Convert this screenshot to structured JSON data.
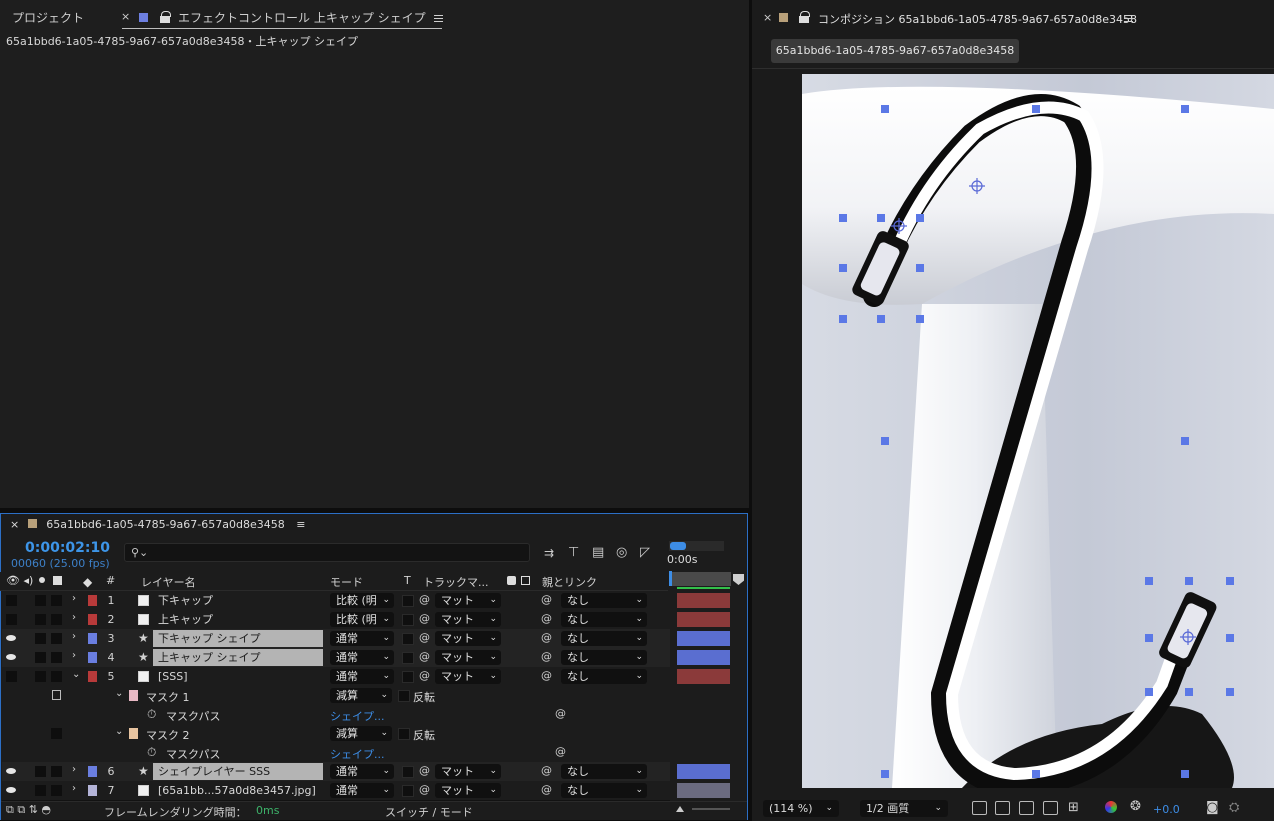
{
  "left_panel": {
    "project_tab": "プロジェクト",
    "effect_tab": "エフェクトコントロール 上キャップ シェイプ",
    "effect_subtitle": "65a1bbd6-1a05-4785-9a67-657a0d8e3458・上キャップ シェイプ",
    "effect_swatch_color": "#6d7fe0"
  },
  "timeline": {
    "tab_title": "65a1bbd6-1a05-4785-9a67-657a0d8e3458",
    "timecode": "0:00:02:10",
    "frame_fps": "00060 (25.00 fps)",
    "search_icon": "search-icon",
    "ruler_label": "0:00s",
    "columns": {
      "layer_name": "レイヤー名",
      "mode": "モード",
      "t": "T",
      "track_matte": "トラックマ...",
      "parent_link": "親とリンク",
      "number": "#"
    },
    "layers": [
      {
        "num": "1",
        "name": "下キャップ",
        "mode": "比較 (明",
        "matte": "マット",
        "parent": "なし",
        "color": "#b83a3a",
        "selected": false,
        "visible": false,
        "star": false,
        "bar": "#8b3a3a"
      },
      {
        "num": "2",
        "name": "上キャップ",
        "mode": "比較 (明",
        "matte": "マット",
        "parent": "なし",
        "color": "#b83a3a",
        "selected": false,
        "visible": false,
        "star": false,
        "bar": "#8b3a3a"
      },
      {
        "num": "3",
        "name": "下キャップ シェイプ",
        "mode": "通常",
        "matte": "マット",
        "parent": "なし",
        "color": "#6a7ee0",
        "selected": true,
        "visible": true,
        "star": true,
        "bar": "#5a6ed0"
      },
      {
        "num": "4",
        "name": "上キャップ シェイプ",
        "mode": "通常",
        "matte": "マット",
        "parent": "なし",
        "color": "#6a7ee0",
        "selected": true,
        "visible": true,
        "star": true,
        "bar": "#5a6ed0"
      },
      {
        "num": "5",
        "name": "[SSS]",
        "mode": "通常",
        "matte": "マット",
        "parent": "なし",
        "color": "#b83a3a",
        "selected": false,
        "visible": false,
        "star": false,
        "bar": "#8b3a3a"
      }
    ],
    "masks": [
      {
        "name": "マスク 1",
        "mode": "減算",
        "invert": "反転",
        "color": "#e8b8c4",
        "path_label": "マスクパス",
        "path_value": "シェイプ..."
      },
      {
        "name": "マスク 2",
        "mode": "減算",
        "invert": "反転",
        "color": "#e8c4a0",
        "path_label": "マスクパス",
        "path_value": "シェイプ..."
      }
    ],
    "layers_after": [
      {
        "num": "6",
        "name": "シェイプレイヤー SSS",
        "mode": "通常",
        "matte": "マット",
        "parent": "なし",
        "color": "#6a7ee0",
        "selected": true,
        "visible": true,
        "star": true,
        "bar": "#5a6ed0"
      },
      {
        "num": "7",
        "name": "[65a1bb...57a0d8e3457.jpg]",
        "mode": "通常",
        "matte": "マット",
        "parent": "なし",
        "color": "#b4b4d8",
        "selected": false,
        "visible": true,
        "star": false,
        "bar": "#6b6b80"
      }
    ],
    "footer_render_label": "フレームレンダリング時間：",
    "footer_render_value": "0ms",
    "footer_switch": "スイッチ / モード"
  },
  "composition": {
    "tab": "コンポジション 65a1bbd6-1a05-4785-9a67-657a0d8e3458",
    "chip": "65a1bbd6-1a05-4785-9a67-657a0d8e3458",
    "swatch_color": "#b8a07a",
    "zoom": "(114 %)",
    "quality": "1/2 画質",
    "exposure": "+0.0"
  }
}
